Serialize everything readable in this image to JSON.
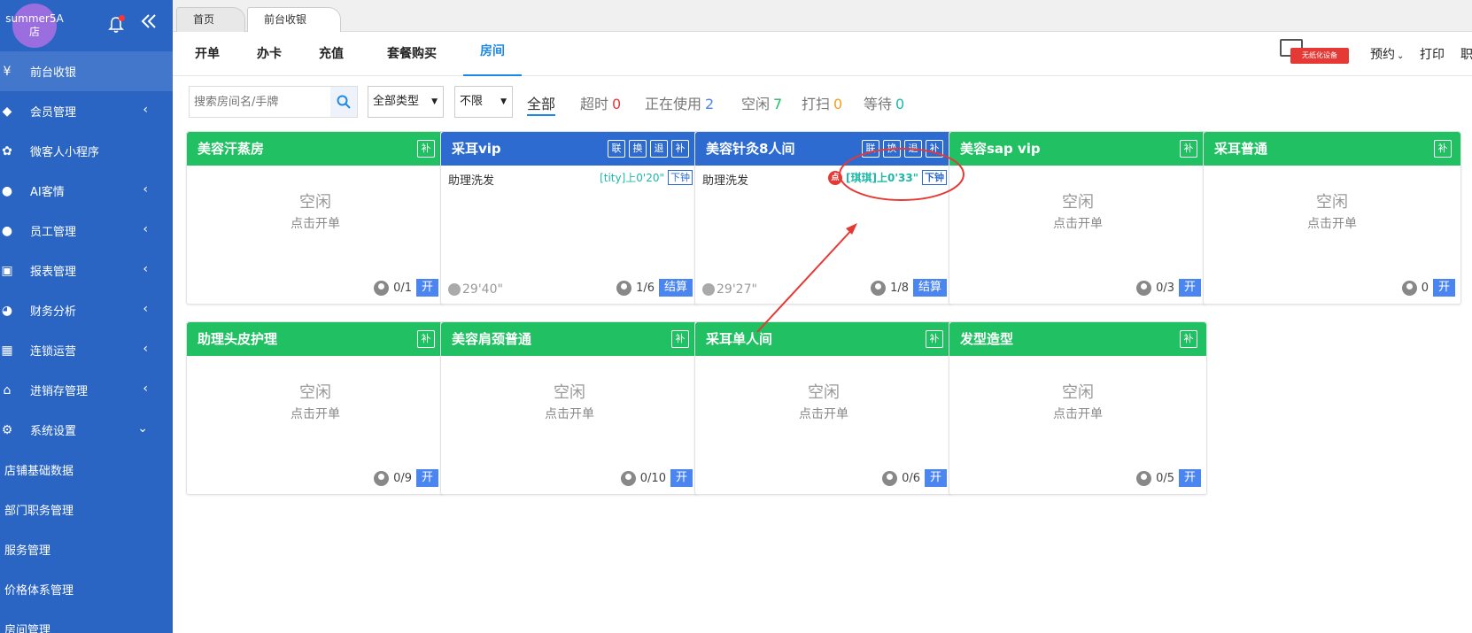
{
  "sidebar": {
    "avatar_text": "summer5A店",
    "items": [
      {
        "label": "前台收银",
        "icon": "yen-icon",
        "arrow": ""
      },
      {
        "label": "会员管理",
        "icon": "tag-icon",
        "arrow": "‹"
      },
      {
        "label": "微客人小程序",
        "icon": "apps-icon",
        "arrow": ""
      },
      {
        "label": "AI客情",
        "icon": "ai-icon",
        "arrow": "‹"
      },
      {
        "label": "员工管理",
        "icon": "user-icon",
        "arrow": "‹"
      },
      {
        "label": "报表管理",
        "icon": "monitor-icon",
        "arrow": "‹"
      },
      {
        "label": "财务分析",
        "icon": "pie-icon",
        "arrow": "‹"
      },
      {
        "label": "连锁运营",
        "icon": "building-icon",
        "arrow": "‹"
      },
      {
        "label": "进销存管理",
        "icon": "home-icon",
        "arrow": "‹"
      },
      {
        "label": "系统设置",
        "icon": "gear-icon",
        "arrow": "⌄"
      }
    ],
    "subitems": [
      "店铺基础数据",
      "部门职务管理",
      "服务管理",
      "价格体系管理",
      "房间管理"
    ]
  },
  "page_tabs": [
    "首页",
    "前台收银"
  ],
  "toolbar": {
    "items": [
      "开单",
      "办卡",
      "充值",
      "套餐购买",
      "房间"
    ],
    "device_badge": "无纸化设备",
    "right": [
      "预约",
      "打印",
      "职"
    ]
  },
  "filters": {
    "search_placeholder": "搜索房间名/手牌",
    "type_select": "全部类型",
    "limit_select": "不限",
    "stats": [
      {
        "label": "全部",
        "count": "",
        "color": "#333333"
      },
      {
        "label": "超时",
        "count": "0",
        "color": "#e53935"
      },
      {
        "label": "正在使用",
        "count": "2",
        "color": "#4b86f0"
      },
      {
        "label": "空闲",
        "count": "7",
        "color": "#21c063"
      },
      {
        "label": "打扫",
        "count": "0",
        "color": "#f0a020"
      },
      {
        "label": "等待",
        "count": "0",
        "color": "#1cb9a8"
      }
    ]
  },
  "rooms": [
    {
      "name": "美容汗蒸房",
      "status": "idle",
      "idle_text": "空闲",
      "tap_text": "点击开单",
      "btns": [
        "补"
      ],
      "occupancy": "0/1",
      "action": "开"
    },
    {
      "name": "采耳vip",
      "status": "busy",
      "service": "助理洗发",
      "timer": "[tity]上0'20\"",
      "down": "下钟",
      "elapsed": "29'40\"",
      "btns": [
        "联",
        "换",
        "退",
        "补"
      ],
      "occupancy": "1/6",
      "action": "结算"
    },
    {
      "name": "美容针灸8人间",
      "status": "busy",
      "service": "助理洗发",
      "dian": "点",
      "timer": "[琪琪]上0'33\"",
      "down": "下钟",
      "elapsed": "29'27\"",
      "btns": [
        "联",
        "换",
        "退",
        "补"
      ],
      "occupancy": "1/8",
      "action": "结算"
    },
    {
      "name": "美容sap vip",
      "status": "idle",
      "idle_text": "空闲",
      "tap_text": "点击开单",
      "btns": [
        "补"
      ],
      "occupancy": "0/3",
      "action": "开"
    },
    {
      "name": "采耳普通",
      "status": "idle",
      "idle_text": "空闲",
      "tap_text": "点击开单",
      "btns": [
        "补"
      ],
      "occupancy": "0",
      "action": "开"
    },
    {
      "name": "助理头皮护理",
      "status": "idle",
      "idle_text": "空闲",
      "tap_text": "点击开单",
      "btns": [
        "补"
      ],
      "occupancy": "0/9",
      "action": "开"
    },
    {
      "name": "美容肩颈普通",
      "status": "idle",
      "idle_text": "空闲",
      "tap_text": "点击开单",
      "btns": [
        "补"
      ],
      "occupancy": "0/10",
      "action": "开"
    },
    {
      "name": "采耳单人间",
      "status": "idle",
      "idle_text": "空闲",
      "tap_text": "点击开单",
      "btns": [
        "补"
      ],
      "occupancy": "0/6",
      "action": "开"
    },
    {
      "name": "发型造型",
      "status": "idle",
      "idle_text": "空闲",
      "tap_text": "点击开单",
      "btns": [
        "补"
      ],
      "occupancy": "0/5",
      "action": "开"
    }
  ],
  "colors": {
    "sidebar": "#2a65c4",
    "accent": "#1e88e5",
    "idle_header": "#21c063",
    "busy_header": "#2d6bd0",
    "annotation": "#e53935"
  }
}
